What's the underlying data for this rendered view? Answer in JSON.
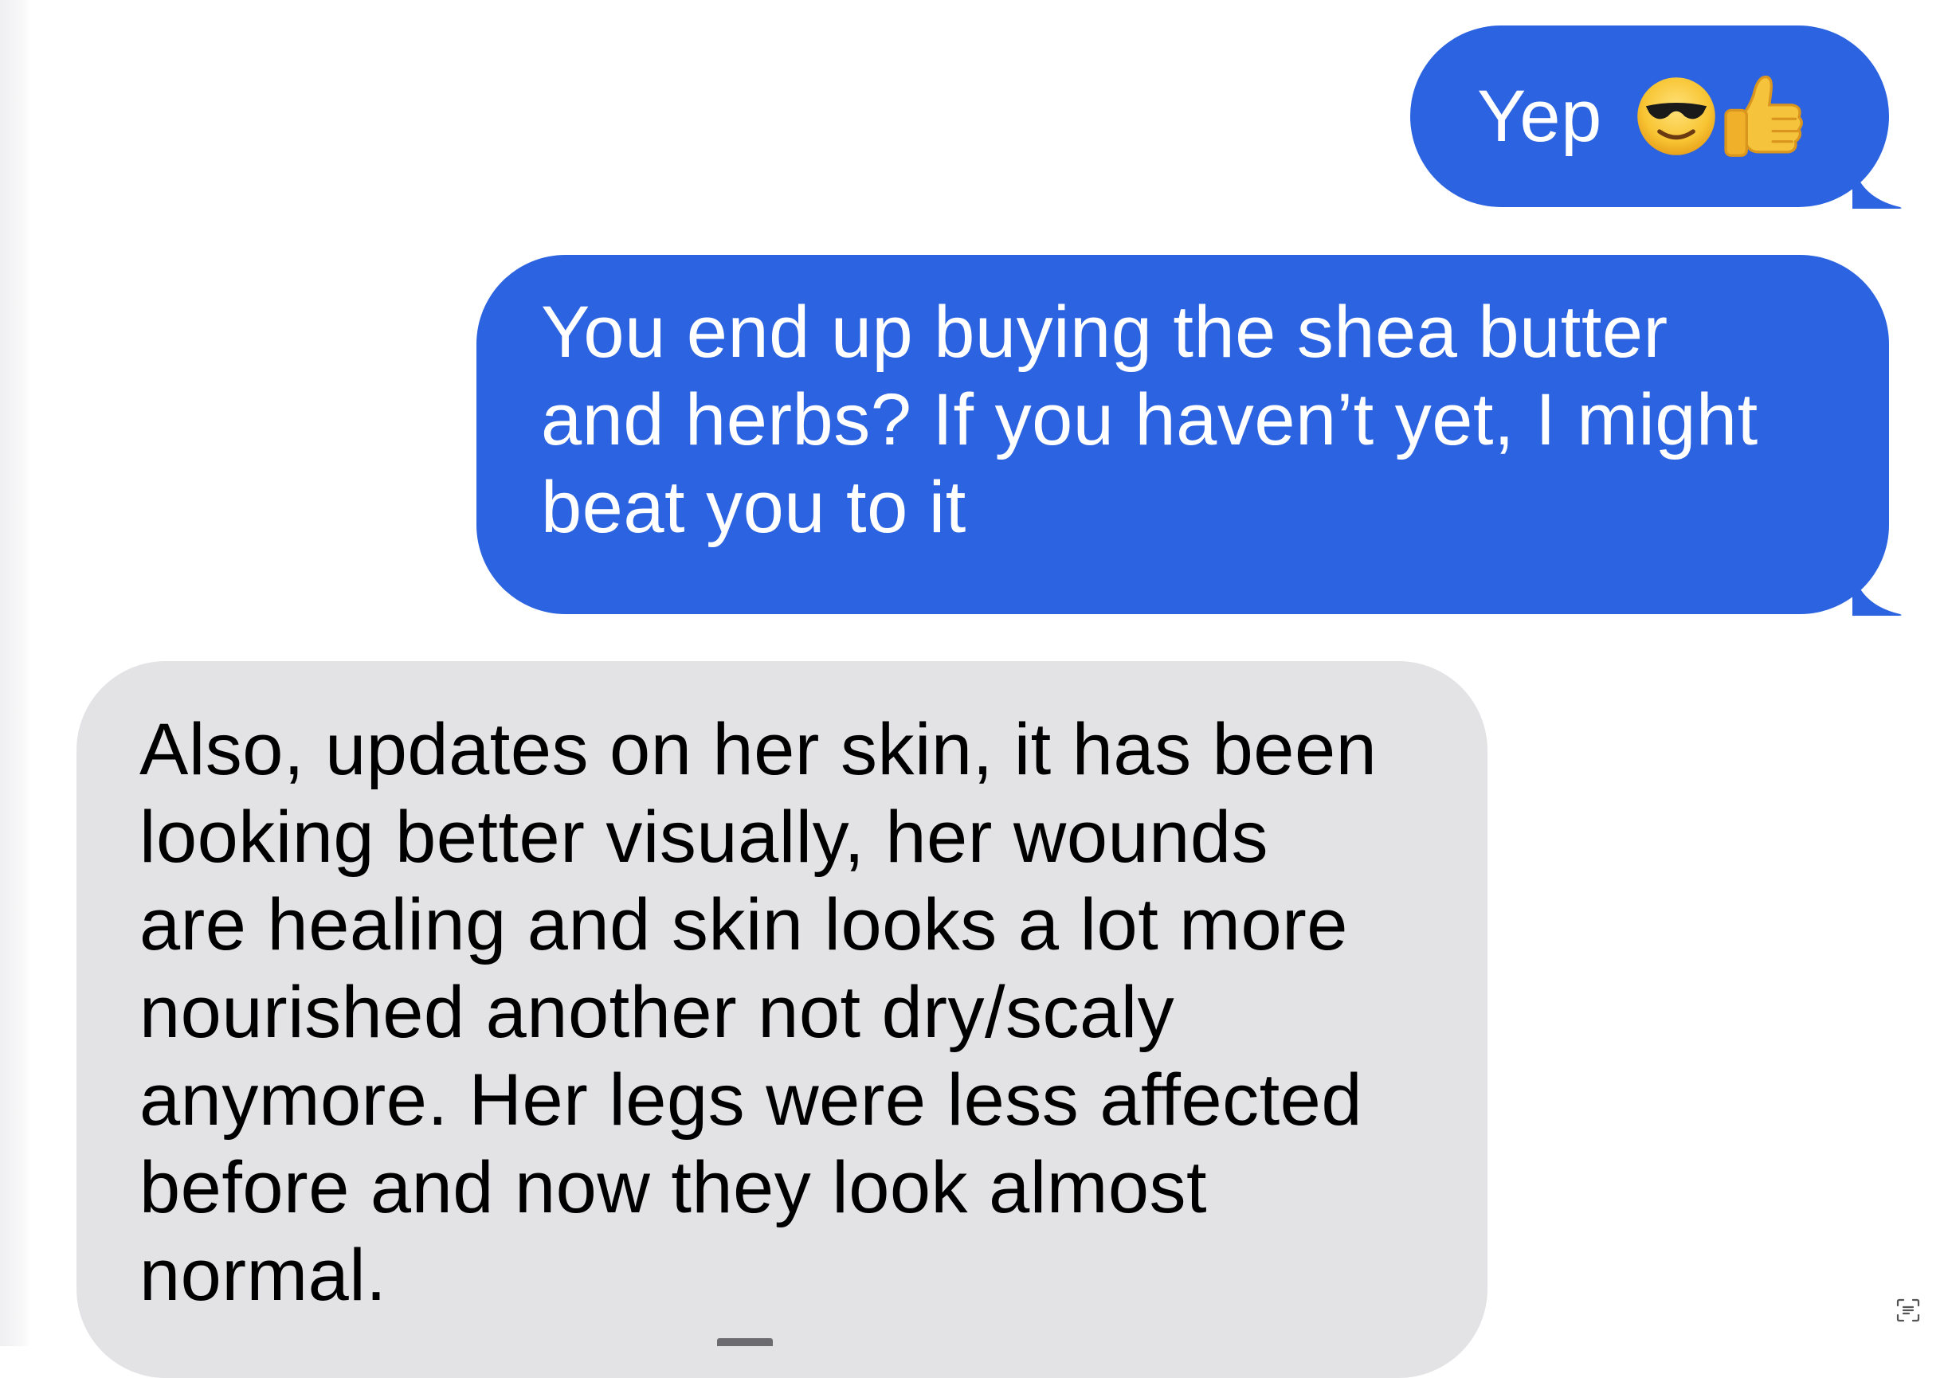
{
  "conversation": {
    "messages": [
      {
        "direction": "sent",
        "text": "Yep",
        "emojis": [
          "smiling-face-with-sunglasses-emoji",
          "thumbs-up-emoji"
        ]
      },
      {
        "direction": "sent",
        "lines": [
          "You end up buying the shea butter",
          "and herbs? If you haven’t yet, I might",
          "beat you to it"
        ]
      },
      {
        "direction": "received",
        "lines": [
          "Also, updates on her skin, it has been",
          "looking better visually, her wounds",
          "are healing and skin looks a lot more",
          "nourished another not dry/scaly",
          "anymore. Her legs were less affected",
          "before and now they look almost",
          "normal."
        ]
      }
    ]
  },
  "colors": {
    "sent_bubble": "#2b63e0",
    "received_bubble": "#e3e3e6",
    "sent_text": "#ffffff",
    "received_text": "#000000"
  },
  "icons": {
    "live_text": "live-text-icon"
  }
}
